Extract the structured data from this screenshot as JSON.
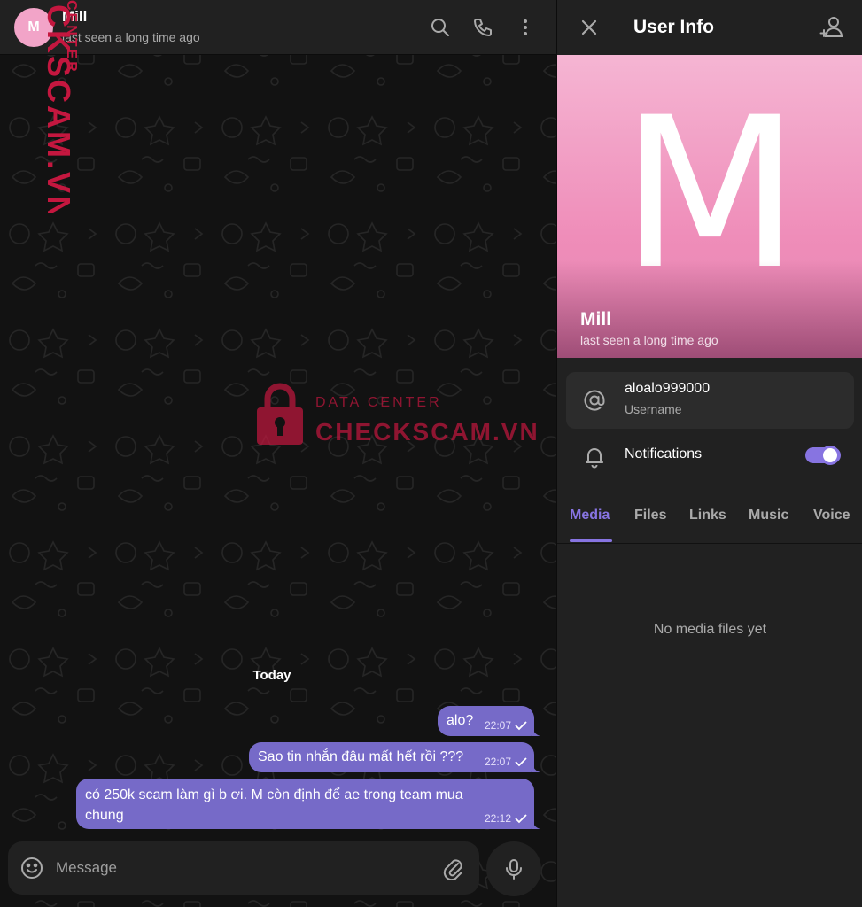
{
  "chat": {
    "header": {
      "avatar_initial": "M",
      "name": "Mill",
      "status": "last seen a long time ago"
    },
    "date_label": "Today",
    "messages": [
      {
        "text": "alo?",
        "time": "22:07"
      },
      {
        "text": "Sao tin nhắn đâu mất hết rồi ???",
        "time": "22:07"
      },
      {
        "text": "có 250k scam làm gì b ơi. M còn định để ae trong team mua chung",
        "time": "22:12"
      }
    ],
    "composer": {
      "placeholder": "Message"
    }
  },
  "watermark": {
    "side_text": "CKSCAM.VN",
    "side_sub": "CENTER",
    "center_top": "DATA CENTER",
    "center_main": "CHECKSCAM.VN",
    "color": "#c4173f"
  },
  "info": {
    "title": "User Info",
    "hero": {
      "letter": "M",
      "name": "Mill",
      "status": "last seen a long time ago"
    },
    "username": {
      "value": "aloalo999000",
      "label": "Username"
    },
    "notifications": {
      "label": "Notifications",
      "enabled": true
    },
    "tabs": [
      "Media",
      "Files",
      "Links",
      "Music",
      "Voice"
    ],
    "active_tab": "Media",
    "empty_text": "No media files yet"
  },
  "colors": {
    "accent": "#8774e1",
    "bubble": "#766ac8",
    "panel": "#212121",
    "background": "#121212",
    "avatar": "#f2a4c8"
  }
}
